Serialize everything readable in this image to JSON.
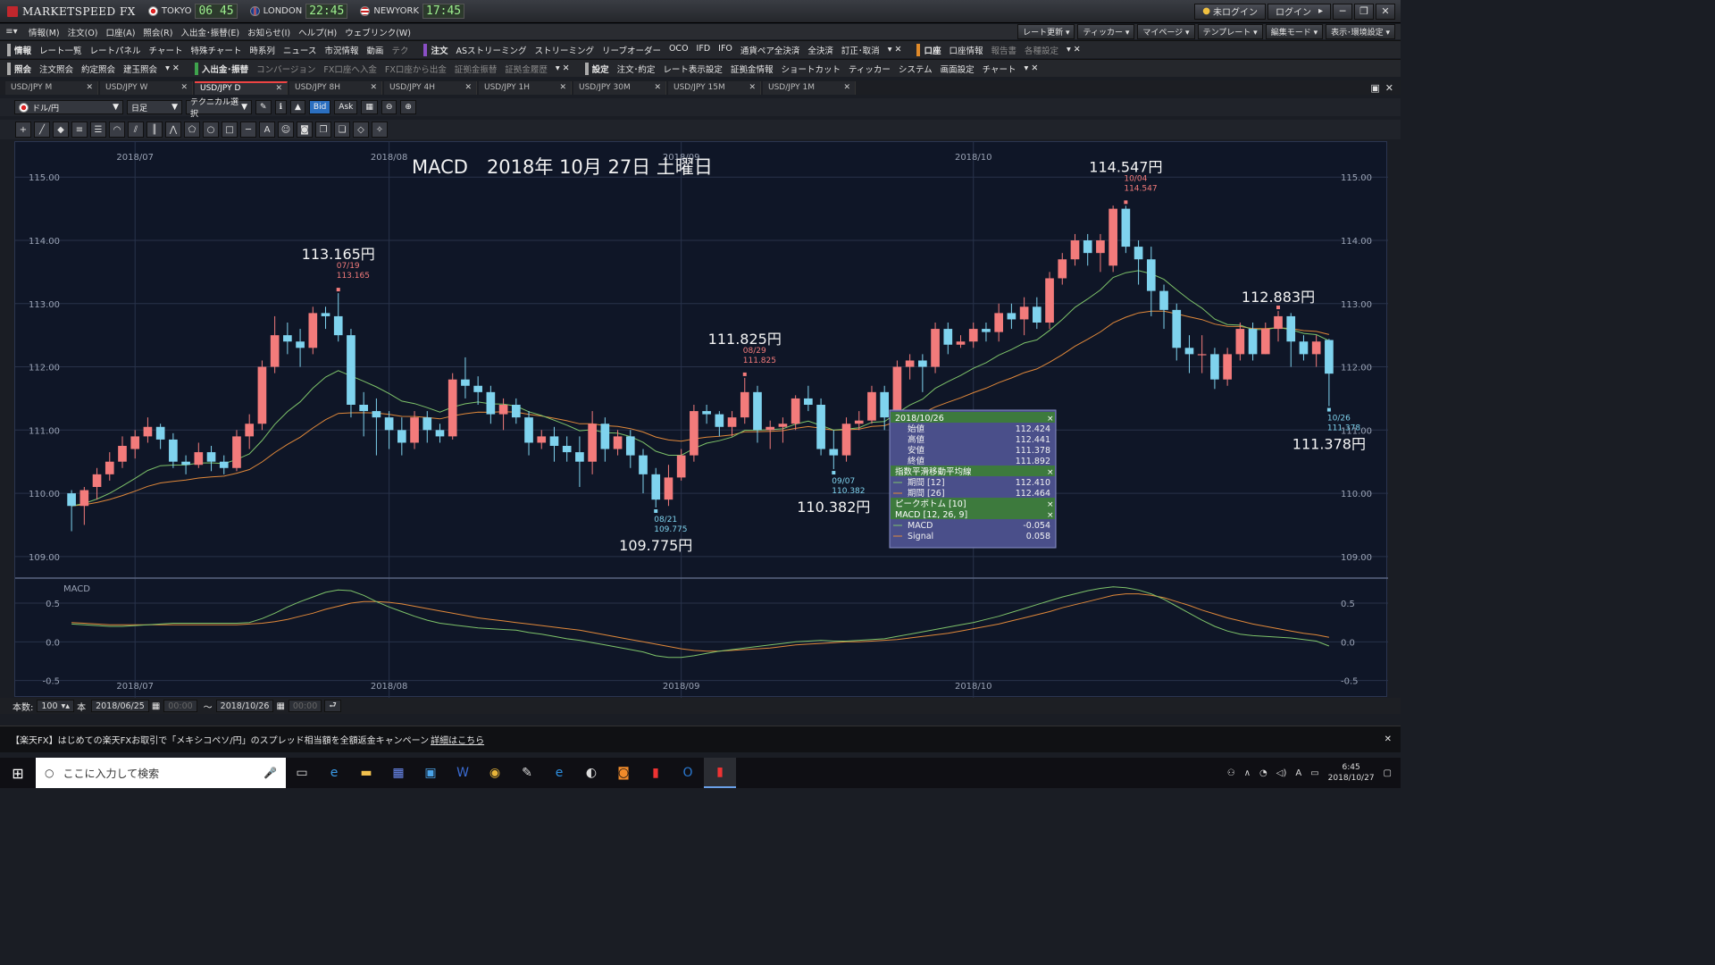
{
  "app": {
    "name": "MARKETSPEED FX"
  },
  "clocks": [
    {
      "city": "TOKYO",
      "time": "06 45"
    },
    {
      "city": "LONDON",
      "time": "22:45"
    },
    {
      "city": "NEWYORK",
      "time": "17:45"
    }
  ],
  "titlebar": {
    "login_status": "未ログイン",
    "login": "ログイン",
    "min": "─",
    "max": "❐",
    "close": "✕"
  },
  "menus": [
    "情報(M)",
    "注文(O)",
    "口座(A)",
    "照会(R)",
    "入出金･振替(E)",
    "お知らせ(I)",
    "ヘルプ(H)",
    "ウェブリンク(W)"
  ],
  "right_tools": [
    "レート更新",
    "ティッカー",
    "マイページ",
    "テンプレート",
    "編集モード",
    "表示･環境設定"
  ],
  "nav1": {
    "info_label": "情報",
    "info_items": [
      "レート一覧",
      "レートパネル",
      "チャート",
      "特殊チャート",
      "時系列",
      "ニュース",
      "市況情報",
      "動画",
      "テク"
    ],
    "order_label": "注文",
    "order_items": [
      "ASストリーミング",
      "ストリーミング",
      "リーブオーダー",
      "OCO",
      "IFD",
      "IFO",
      "通貨ペア全決済",
      "全決済",
      "訂正･取消"
    ],
    "account_label": "口座",
    "account_items": [
      "口座情報",
      "報告書",
      "各種設定"
    ]
  },
  "nav2": {
    "inquiry_label": "照会",
    "inquiry_items": [
      "注文照会",
      "約定照会",
      "建玉照会"
    ],
    "transfer_label": "入出金･振替",
    "transfer_items": [
      "コンバージョン",
      "FX口座へ入金",
      "FX口座から出金",
      "証拠金振替",
      "証拠金履歴"
    ],
    "settings_label": "設定",
    "settings_items": [
      "注文･約定",
      "レート表示設定",
      "証拠金情報",
      "ショートカット",
      "ティッカー",
      "システム",
      "画面設定",
      "チャート"
    ]
  },
  "tabs": [
    {
      "label": "USD/JPY M",
      "active": false
    },
    {
      "label": "USD/JPY W",
      "active": false
    },
    {
      "label": "USD/JPY D",
      "active": true
    },
    {
      "label": "USD/JPY 8H",
      "active": false
    },
    {
      "label": "USD/JPY 4H",
      "active": false
    },
    {
      "label": "USD/JPY 1H",
      "active": false
    },
    {
      "label": "USD/JPY 30M",
      "active": false
    },
    {
      "label": "USD/JPY 15M",
      "active": false
    },
    {
      "label": "USD/JPY 1M",
      "active": false
    }
  ],
  "chart_toolbar": {
    "pair": "ドル/円",
    "period": "日足",
    "technical": "テクニカル選択",
    "bid": "Bid",
    "ask": "Ask"
  },
  "bottom": {
    "count_label": "本数:",
    "count": "100",
    "unit": "本",
    "from": "2018/06/25",
    "from_time": "00:00",
    "tilde": "～",
    "to": "2018/10/26",
    "to_time": "00:00"
  },
  "ticker_text": "【楽天FX】はじめての楽天FXお取引で「メキシコペソ/円」のスプレッド相当額を全額返金キャンペーン",
  "ticker_link": "詳細はこちら",
  "taskbar": {
    "search": "ここに入力して検索",
    "time": "6:45",
    "date": "2018/10/27",
    "ime": "A"
  },
  "chart_data": {
    "type": "candlestick",
    "title": "MACD　2018年 10月 27日 土曜日",
    "ylim": [
      108.8,
      115.3
    ],
    "yticks": [
      "115.00",
      "114.00",
      "113.00",
      "112.00",
      "111.00",
      "110.00",
      "109.00"
    ],
    "month_labels": [
      "2018/07",
      "2018/08",
      "2018/09",
      "2018/10"
    ],
    "colors": {
      "up": "#f37b7b",
      "down": "#7fd3ee",
      "ema12": "#7ec36a",
      "ema26": "#e0883a",
      "macd": "#7ec36a",
      "signal": "#e0883a"
    },
    "candles": [
      [
        110.0,
        109.8,
        110.05,
        109.4
      ],
      [
        109.8,
        110.05,
        110.1,
        109.5
      ],
      [
        110.1,
        110.3,
        110.4,
        109.9
      ],
      [
        110.3,
        110.5,
        110.65,
        110.2
      ],
      [
        110.5,
        110.75,
        110.9,
        110.4
      ],
      [
        110.7,
        110.9,
        111.0,
        110.55
      ],
      [
        110.9,
        111.05,
        111.2,
        110.8
      ],
      [
        111.05,
        110.85,
        111.1,
        110.7
      ],
      [
        110.85,
        110.5,
        110.95,
        110.4
      ],
      [
        110.5,
        110.45,
        110.6,
        110.3
      ],
      [
        110.45,
        110.65,
        110.8,
        110.4
      ],
      [
        110.65,
        110.5,
        110.75,
        110.35
      ],
      [
        110.5,
        110.4,
        110.6,
        110.3
      ],
      [
        110.4,
        110.9,
        111.0,
        110.35
      ],
      [
        110.9,
        111.1,
        111.25,
        110.7
      ],
      [
        111.1,
        112.0,
        112.1,
        111.0
      ],
      [
        112.0,
        112.5,
        112.8,
        111.9
      ],
      [
        112.5,
        112.4,
        112.7,
        112.2
      ],
      [
        112.4,
        112.3,
        112.6,
        112.0
      ],
      [
        112.3,
        112.85,
        112.95,
        112.2
      ],
      [
        112.85,
        112.8,
        112.95,
        112.6
      ],
      [
        112.8,
        112.5,
        113.165,
        112.4
      ],
      [
        112.5,
        111.4,
        112.6,
        111.2
      ],
      [
        111.4,
        111.3,
        111.6,
        110.9
      ],
      [
        111.3,
        111.2,
        111.5,
        110.6
      ],
      [
        111.2,
        111.0,
        111.3,
        110.7
      ],
      [
        111.0,
        110.8,
        111.2,
        110.6
      ],
      [
        110.8,
        111.2,
        111.3,
        110.7
      ],
      [
        111.2,
        111.0,
        111.3,
        110.8
      ],
      [
        111.0,
        110.9,
        111.1,
        110.8
      ],
      [
        110.9,
        111.8,
        111.9,
        110.85
      ],
      [
        111.8,
        111.7,
        112.15,
        111.5
      ],
      [
        111.7,
        111.6,
        111.85,
        111.4
      ],
      [
        111.6,
        111.25,
        111.7,
        111.1
      ],
      [
        111.25,
        111.4,
        111.5,
        111.0
      ],
      [
        111.4,
        111.2,
        111.5,
        111.1
      ],
      [
        111.2,
        110.8,
        111.3,
        110.6
      ],
      [
        110.8,
        110.9,
        111.0,
        110.7
      ],
      [
        110.9,
        110.75,
        111.05,
        110.5
      ],
      [
        110.75,
        110.65,
        110.9,
        110.5
      ],
      [
        110.65,
        110.5,
        110.9,
        110.1
      ],
      [
        110.5,
        111.1,
        111.3,
        110.3
      ],
      [
        111.1,
        110.7,
        111.2,
        110.5
      ],
      [
        110.7,
        110.9,
        111.0,
        110.6
      ],
      [
        110.9,
        110.6,
        111.0,
        110.4
      ],
      [
        110.6,
        110.3,
        110.7,
        110.0
      ],
      [
        110.3,
        109.9,
        110.4,
        109.775
      ],
      [
        109.9,
        110.25,
        110.45,
        109.8
      ],
      [
        110.25,
        110.6,
        110.7,
        110.2
      ],
      [
        110.6,
        111.3,
        111.4,
        110.5
      ],
      [
        111.3,
        111.25,
        111.4,
        111.1
      ],
      [
        111.25,
        111.05,
        111.3,
        110.9
      ],
      [
        111.05,
        111.2,
        111.3,
        110.9
      ],
      [
        111.2,
        111.6,
        111.825,
        111.1
      ],
      [
        111.6,
        111.0,
        111.7,
        110.8
      ],
      [
        111.0,
        111.05,
        111.15,
        110.7
      ],
      [
        111.05,
        111.1,
        111.2,
        110.8
      ],
      [
        111.1,
        111.5,
        111.55,
        111.0
      ],
      [
        111.5,
        111.4,
        111.7,
        111.3
      ],
      [
        111.4,
        110.7,
        111.5,
        110.6
      ],
      [
        110.7,
        110.6,
        111.0,
        110.382
      ],
      [
        110.6,
        111.1,
        111.2,
        110.5
      ],
      [
        111.1,
        111.15,
        111.3,
        111.0
      ],
      [
        111.15,
        111.6,
        111.7,
        111.1
      ],
      [
        111.6,
        111.2,
        111.7,
        111.0
      ],
      [
        111.2,
        112.0,
        112.1,
        111.15
      ],
      [
        112.0,
        112.1,
        112.2,
        111.8
      ],
      [
        112.1,
        112.0,
        112.2,
        111.6
      ],
      [
        112.0,
        112.6,
        112.7,
        111.9
      ],
      [
        112.6,
        112.35,
        112.7,
        112.2
      ],
      [
        112.35,
        112.4,
        112.5,
        112.3
      ],
      [
        112.4,
        112.6,
        112.7,
        112.3
      ],
      [
        112.6,
        112.55,
        112.7,
        112.4
      ],
      [
        112.55,
        112.85,
        113.0,
        112.4
      ],
      [
        112.85,
        112.75,
        113.0,
        112.6
      ],
      [
        112.75,
        112.95,
        113.1,
        112.5
      ],
      [
        112.95,
        112.7,
        113.1,
        112.6
      ],
      [
        112.7,
        113.4,
        113.5,
        112.6
      ],
      [
        113.4,
        113.7,
        113.8,
        113.3
      ],
      [
        113.7,
        114.0,
        114.1,
        113.6
      ],
      [
        114.0,
        113.8,
        114.1,
        113.6
      ],
      [
        113.8,
        114.0,
        114.1,
        113.5
      ],
      [
        113.6,
        114.5,
        114.55,
        113.5
      ],
      [
        114.5,
        113.9,
        114.547,
        113.8
      ],
      [
        113.9,
        113.7,
        114.0,
        113.3
      ],
      [
        113.7,
        113.2,
        113.9,
        112.8
      ],
      [
        113.2,
        112.9,
        113.3,
        112.6
      ],
      [
        112.9,
        112.3,
        113.0,
        112.1
      ],
      [
        112.3,
        112.2,
        112.5,
        111.9
      ],
      [
        112.2,
        112.2,
        112.5,
        111.9
      ],
      [
        112.2,
        111.8,
        112.3,
        111.65
      ],
      [
        111.8,
        112.2,
        112.3,
        111.7
      ],
      [
        112.2,
        112.6,
        112.7,
        112.1
      ],
      [
        112.6,
        112.2,
        112.7,
        112.1
      ],
      [
        112.2,
        112.6,
        112.7,
        112.2
      ],
      [
        112.6,
        112.8,
        112.883,
        112.4
      ],
      [
        112.8,
        112.4,
        112.85,
        112.0
      ],
      [
        112.4,
        112.2,
        112.5,
        112.1
      ],
      [
        112.2,
        112.4,
        112.5,
        112.0
      ],
      [
        112.424,
        111.892,
        112.441,
        111.378
      ]
    ],
    "peaks": [
      {
        "i": 21,
        "date": "07/19",
        "price": "113.165",
        "big": "113.165円",
        "pos": "high"
      },
      {
        "i": 46,
        "date": "08/21",
        "price": "109.775",
        "big": "109.775円",
        "pos": "low"
      },
      {
        "i": 53,
        "date": "08/29",
        "price": "111.825",
        "big": "111.825円",
        "pos": "high"
      },
      {
        "i": 60,
        "date": "09/07",
        "price": "110.382",
        "big": "110.382円",
        "pos": "low"
      },
      {
        "i": 83,
        "date": "10/04",
        "price": "114.547",
        "big": "114.547円",
        "pos": "high"
      },
      {
        "i": 95,
        "date": "",
        "price": "",
        "big": "112.883円",
        "pos": "high"
      },
      {
        "i": 99,
        "date": "10/26",
        "price": "111.378",
        "big": "111.378円",
        "pos": "low"
      }
    ],
    "macd_panel": {
      "label": "MACD",
      "yticks": [
        "0.5",
        "0.0",
        "-0.5"
      ],
      "ylim": [
        -0.7,
        0.8
      ]
    },
    "macd": [
      0.23,
      0.22,
      0.21,
      0.2,
      0.2,
      0.21,
      0.22,
      0.23,
      0.24,
      0.24,
      0.24,
      0.24,
      0.24,
      0.24,
      0.25,
      0.3,
      0.37,
      0.45,
      0.52,
      0.58,
      0.64,
      0.67,
      0.66,
      0.6,
      0.52,
      0.45,
      0.39,
      0.33,
      0.28,
      0.24,
      0.22,
      0.2,
      0.18,
      0.17,
      0.16,
      0.15,
      0.12,
      0.1,
      0.07,
      0.04,
      0.02,
      -0.01,
      -0.04,
      -0.07,
      -0.1,
      -0.13,
      -0.18,
      -0.2,
      -0.2,
      -0.18,
      -0.15,
      -0.12,
      -0.1,
      -0.08,
      -0.06,
      -0.04,
      -0.02,
      0.0,
      0.01,
      0.02,
      0.01,
      0.01,
      0.02,
      0.03,
      0.04,
      0.07,
      0.1,
      0.13,
      0.16,
      0.19,
      0.22,
      0.25,
      0.29,
      0.33,
      0.38,
      0.43,
      0.48,
      0.53,
      0.58,
      0.62,
      0.66,
      0.69,
      0.71,
      0.7,
      0.67,
      0.62,
      0.55,
      0.46,
      0.37,
      0.28,
      0.2,
      0.14,
      0.1,
      0.08,
      0.07,
      0.06,
      0.05,
      0.03,
      0.01,
      -0.054
    ],
    "signal": [
      0.25,
      0.24,
      0.23,
      0.22,
      0.22,
      0.22,
      0.22,
      0.22,
      0.22,
      0.22,
      0.22,
      0.22,
      0.22,
      0.22,
      0.23,
      0.24,
      0.26,
      0.29,
      0.33,
      0.37,
      0.42,
      0.46,
      0.5,
      0.52,
      0.52,
      0.51,
      0.49,
      0.46,
      0.43,
      0.4,
      0.37,
      0.34,
      0.31,
      0.29,
      0.27,
      0.25,
      0.23,
      0.21,
      0.19,
      0.17,
      0.15,
      0.12,
      0.09,
      0.06,
      0.03,
      0.0,
      -0.03,
      -0.06,
      -0.09,
      -0.11,
      -0.12,
      -0.12,
      -0.11,
      -0.1,
      -0.09,
      -0.08,
      -0.06,
      -0.04,
      -0.03,
      -0.02,
      -0.01,
      0.0,
      0.0,
      0.01,
      0.02,
      0.03,
      0.05,
      0.07,
      0.09,
      0.11,
      0.14,
      0.17,
      0.2,
      0.23,
      0.27,
      0.31,
      0.35,
      0.39,
      0.44,
      0.48,
      0.52,
      0.56,
      0.6,
      0.62,
      0.62,
      0.6,
      0.57,
      0.52,
      0.47,
      0.41,
      0.36,
      0.31,
      0.27,
      0.23,
      0.2,
      0.17,
      0.14,
      0.11,
      0.09,
      0.058
    ],
    "tooltip": {
      "date": "2018/10/26",
      "ohlc": [
        [
          "始値",
          "112.424"
        ],
        [
          "高値",
          "112.441"
        ],
        [
          "安値",
          "111.378"
        ],
        [
          "終値",
          "111.892"
        ]
      ],
      "ema_title": "指数平滑移動平均線",
      "ema": [
        [
          "期間 [12]",
          "112.410"
        ],
        [
          "期間 [26]",
          "112.464"
        ]
      ],
      "peak_title": "ピークボトム [10]",
      "macd_title": "MACD [12, 26, 9]",
      "macd_vals": [
        [
          "MACD",
          "-0.054"
        ],
        [
          "Signal",
          "0.058"
        ]
      ]
    }
  }
}
